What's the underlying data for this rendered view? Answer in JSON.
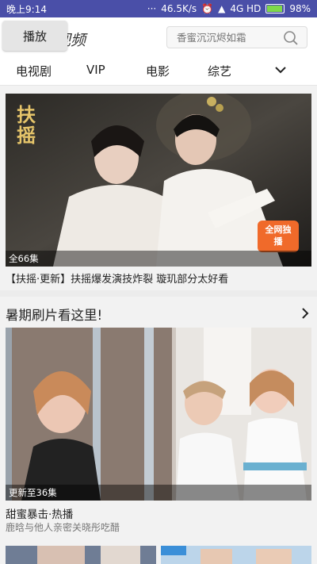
{
  "status_bar": {
    "time": "晚上9:14",
    "network_speed": "46.5K/s",
    "network": "4G HD",
    "battery": "98%"
  },
  "header": {
    "logo_text": "视频",
    "play_button_label": "播放",
    "search_placeholder": "香蜜沉沉烬如霜"
  },
  "tabs": [
    "电视剧",
    "VIP",
    "电影",
    "综艺"
  ],
  "hero": {
    "poster_title": "扶摇",
    "stamp_text": "全网独播",
    "episode_badge": "全66集",
    "caption": "【扶摇·更新】扶摇爆发演技炸裂 璇玑部分太好看"
  },
  "section": {
    "title": "暑期刷片看这里!"
  },
  "card2": {
    "episode_badge": "更新至36集",
    "title": "甜蜜暴击·热播",
    "subtitle": "鹿晗与他人亲密关晓彤吃醋"
  },
  "colors": {
    "status_bar": "#4a4fa8",
    "accent": "#3b8fd8"
  }
}
